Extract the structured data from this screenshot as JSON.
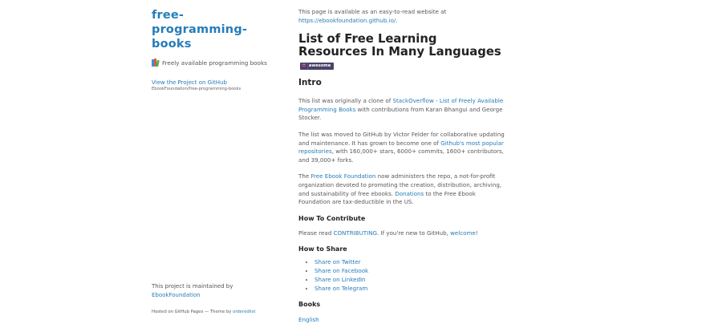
{
  "sidebar": {
    "title_line1": "free-",
    "title_line2": "programming-",
    "title_line3": "books",
    "tagline": "Freely available programming books",
    "books_icon": "books-icon",
    "view_link": "View the Project on GitHub",
    "repo_path": "EbookFoundation/free-programming-books",
    "maintained_text": "This project is maintained by",
    "maintainer": "EbookFoundation",
    "hosted_prefix": "Hosted on GitHub Pages — Theme by ",
    "theme_author": "orderedlist"
  },
  "main": {
    "available_text": "This page is available as an easy-to-read website at",
    "available_link": "https://ebookfoundation.github.io/",
    "available_end": ".",
    "title": "List of Free Learning Resources In Many Languages",
    "badge_left": "😎",
    "badge_right": "awesome",
    "intro_heading": "Intro",
    "intro_p1_a": "This list was originally a clone of ",
    "intro_p1_link": "StackOverflow - List of Freely Available Programming Books",
    "intro_p1_b": " with contributions from Karan Bhangui and George Stocker.",
    "intro_p2_a": "The list was moved to GitHub by Victor Felder for collaborative updating and maintenance. It has grown to become one of ",
    "intro_p2_link": "Github's most popular repositories",
    "intro_p2_b": ", with 160,000+ stars, 6000+ commits, 1600+ contributors, and 39,000+ forks.",
    "intro_p3_a": "The ",
    "intro_p3_link1": "Free Ebook Foundation",
    "intro_p3_b": " now administers the repo, a not-for-profit organization devoted to promoting the creation, distribution, archiving, and sustainability of free ebooks. ",
    "intro_p3_link2": "Donations",
    "intro_p3_c": " to the Free Ebook Foundation are tax-deductible in the US.",
    "contribute_heading": "How To Contribute",
    "contribute_a": "Please read ",
    "contribute_link1": "CONTRIBUTING",
    "contribute_b": ". If you're new to GitHub, ",
    "contribute_link2": "welcome",
    "contribute_c": "!",
    "share_heading": "How to Share",
    "share_items": [
      "Share on Twitter",
      "Share on Facebook",
      "Share on LinkedIn",
      "Share on Telegram"
    ],
    "books_heading": "Books",
    "books_link": "English"
  },
  "colors": {
    "link": "#267CB9",
    "heading": "#222222",
    "body_text": "#595959",
    "badge_bg": "#494368",
    "badge_glasses": "#FC60A8"
  }
}
